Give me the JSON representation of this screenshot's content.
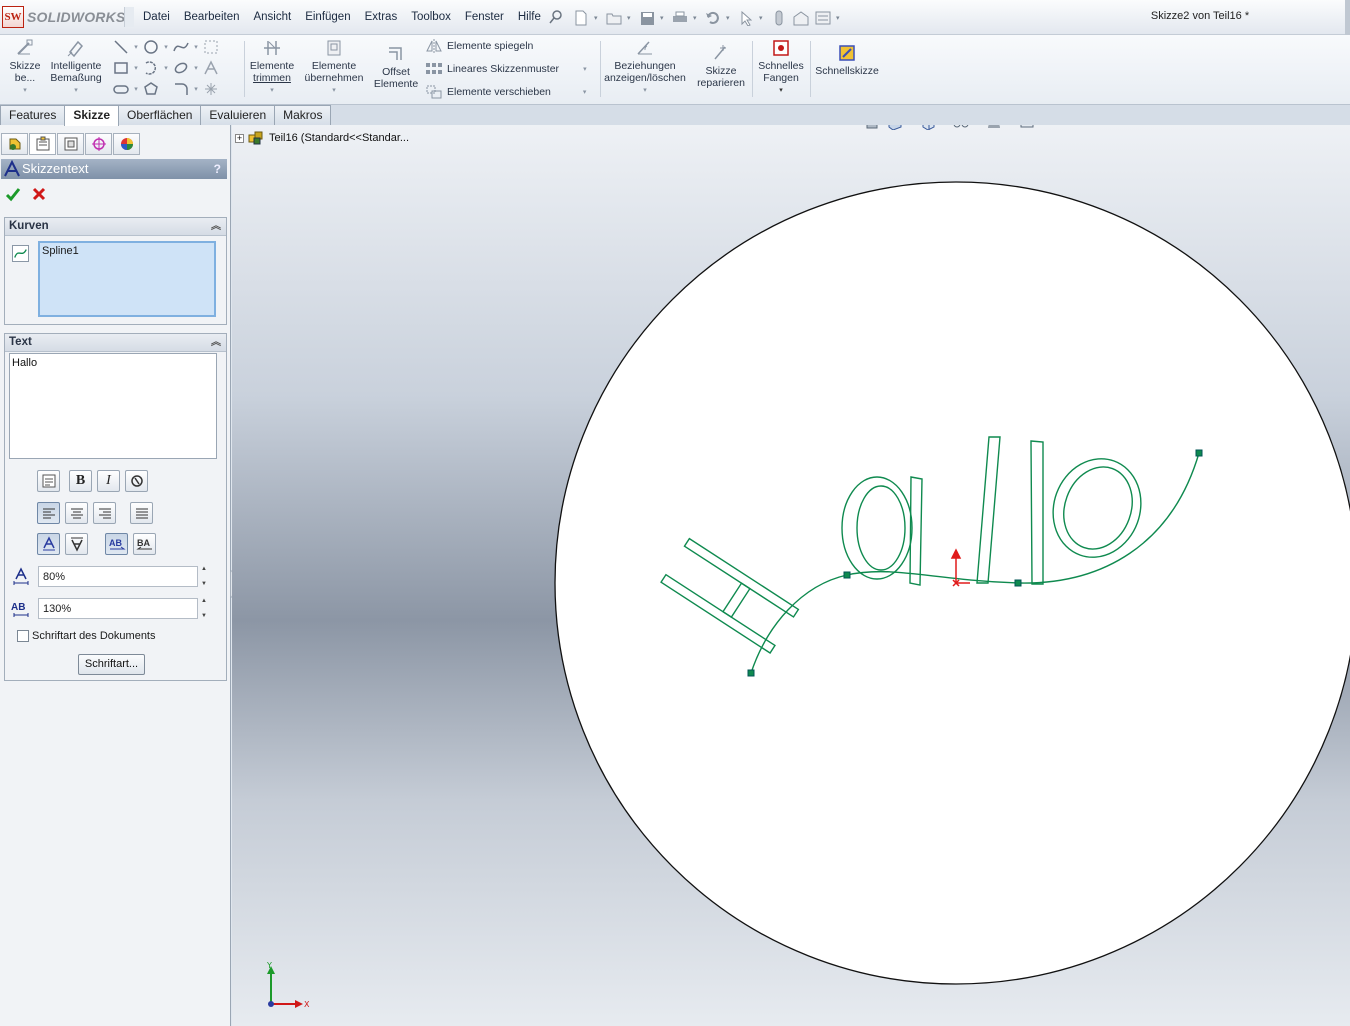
{
  "app": {
    "logo_mark": "SW",
    "logo_text": "SOLIDWORKS",
    "document_title": "Skizze2 von Teil16 *"
  },
  "menu": [
    "Datei",
    "Bearbeiten",
    "Ansicht",
    "Einfügen",
    "Extras",
    "Toolbox",
    "Fenster",
    "Hilfe"
  ],
  "commands": {
    "edit_sketch": [
      "Skizze",
      "be..."
    ],
    "smart_dimension": [
      "Intelligente",
      "Bemaßung"
    ],
    "trim": [
      "Elemente",
      "trimmen"
    ],
    "convert": [
      "Elemente",
      "übernehmen"
    ],
    "offset": [
      "Offset",
      "Elemente"
    ],
    "mirror": "Elemente spiegeln",
    "linear_pattern": "Lineares Skizzenmuster",
    "move": "Elemente verschieben",
    "relations": [
      "Beziehungen",
      "anzeigen/löschen"
    ],
    "repair": [
      "Skizze",
      "reparieren"
    ],
    "quick_snaps": [
      "Schnelles",
      "Fangen"
    ],
    "rapid_sketch": "Schnellskizze"
  },
  "tabs": [
    {
      "label": "Features",
      "active": false
    },
    {
      "label": "Skizze",
      "active": true
    },
    {
      "label": "Oberflächen",
      "active": false
    },
    {
      "label": "Evaluieren",
      "active": false
    },
    {
      "label": "Makros",
      "active": false
    }
  ],
  "property_manager": {
    "title": "Skizzentext",
    "help": "?",
    "curves": {
      "heading": "Kurven",
      "items": [
        "Spline1"
      ]
    },
    "text": {
      "heading": "Text",
      "value": "Hallo",
      "bold": "B",
      "italic": "I",
      "width_factor": "80%",
      "spacing": "130%",
      "use_document_font_label": "Schriftart des Dokuments",
      "use_document_font": false,
      "font_button": "Schriftart..."
    }
  },
  "feature_tree": {
    "root": "Teil16  (Standard<<Standar..."
  },
  "sketch": {
    "text": "Hallo",
    "colors": {
      "geometry": "#0f8a4f",
      "circle": "#111111",
      "origin": "#e01b1b"
    }
  },
  "triad": {
    "x": "X",
    "y": "Y"
  }
}
